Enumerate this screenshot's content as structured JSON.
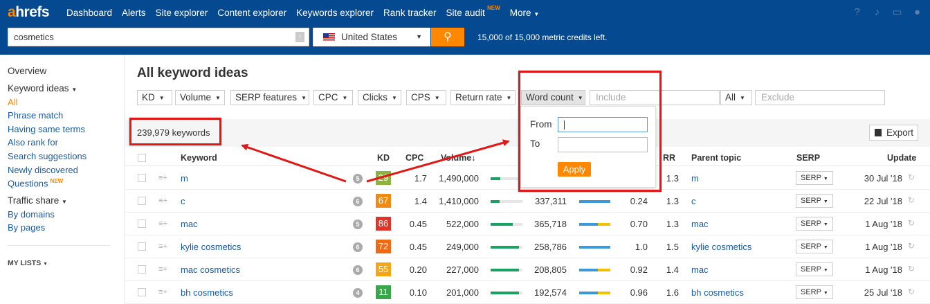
{
  "nav": {
    "logo_a": "a",
    "logo_rest": "hrefs",
    "items": [
      "Dashboard",
      "Alerts",
      "Site explorer",
      "Content explorer",
      "Keywords explorer",
      "Rank tracker",
      "Site audit"
    ],
    "new_badge": "NEW",
    "more": "More",
    "icons": [
      "help-icon",
      "bell-icon",
      "monitor-icon",
      "user-icon"
    ]
  },
  "search": {
    "query": "cosmetics",
    "country": "United States",
    "credits": "15,000 of 15,000 metric credits left."
  },
  "sidebar": {
    "overview": "Overview",
    "keyword_ideas": "Keyword ideas",
    "links": [
      "All",
      "Phrase match",
      "Having same terms",
      "Also rank for",
      "Search suggestions",
      "Newly discovered",
      "Questions"
    ],
    "questions_badge": "NEW",
    "traffic_share": "Traffic share",
    "traffic_links": [
      "By domains",
      "By pages"
    ],
    "my_lists": "MY LISTS"
  },
  "main": {
    "title": "All keyword ideas",
    "filters": [
      "KD",
      "Volume",
      "SERP features",
      "CPC",
      "Clicks",
      "CPS",
      "Return rate",
      "Word count"
    ],
    "include_placeholder": "Include",
    "all_label": "All",
    "exclude_placeholder": "Exclude",
    "count": "239,979 keywords",
    "export": "Export"
  },
  "popup": {
    "from": "From",
    "to": "To",
    "apply": "Apply"
  },
  "columns": [
    "Keyword",
    "KD",
    "CPC",
    "Volume",
    "RR",
    "Parent topic",
    "SERP",
    "Update"
  ],
  "rows": [
    {
      "keyword": "m",
      "sf": "5",
      "kd": "29",
      "kd_color": "#8cb33a",
      "cpc": "1.7",
      "volume": "1,490,000",
      "vol_pct": 30,
      "clicks": "",
      "click_paid": 0,
      "cps": "",
      "rr": "1.3",
      "parent": "m",
      "serp": "SERP",
      "update": "30 Jul '18"
    },
    {
      "keyword": "c",
      "sf": "6",
      "kd": "67",
      "kd_color": "#f08a12",
      "cpc": "1.4",
      "volume": "1,410,000",
      "vol_pct": 28,
      "clicks": "337,311",
      "click_paid": 0,
      "cps": "0.24",
      "rr": "1.3",
      "parent": "c",
      "serp": "SERP",
      "update": "22 Jul '18"
    },
    {
      "keyword": "mac",
      "sf": "5",
      "kd": "86",
      "kd_color": "#e0332a",
      "cpc": "0.45",
      "volume": "522,000",
      "vol_pct": 70,
      "clicks": "365,718",
      "click_paid": 40,
      "cps": "0.70",
      "rr": "1.3",
      "parent": "mac",
      "serp": "SERP",
      "update": "1 Aug '18"
    },
    {
      "keyword": "kylie cosmetics",
      "sf": "6",
      "kd": "72",
      "kd_color": "#f06a16",
      "cpc": "0.45",
      "volume": "249,000",
      "vol_pct": 90,
      "clicks": "258,786",
      "click_paid": 0,
      "cps": "1.0",
      "rr": "1.5",
      "parent": "kylie cosmetics",
      "serp": "SERP",
      "update": "1 Aug '18"
    },
    {
      "keyword": "mac cosmetics",
      "sf": "6",
      "kd": "55",
      "kd_color": "#f5a612",
      "cpc": "0.20",
      "volume": "227,000",
      "vol_pct": 90,
      "clicks": "208,805",
      "click_paid": 40,
      "cps": "0.92",
      "rr": "1.4",
      "parent": "mac",
      "serp": "SERP",
      "update": "1 Aug '18"
    },
    {
      "keyword": "bh cosmetics",
      "sf": "4",
      "kd": "11",
      "kd_color": "#3aa64a",
      "cpc": "0.10",
      "volume": "201,000",
      "vol_pct": 90,
      "clicks": "192,574",
      "click_paid": 40,
      "cps": "0.96",
      "rr": "1.6",
      "parent": "bh cosmetics",
      "serp": "SERP",
      "update": "25 Jul '18"
    }
  ]
}
